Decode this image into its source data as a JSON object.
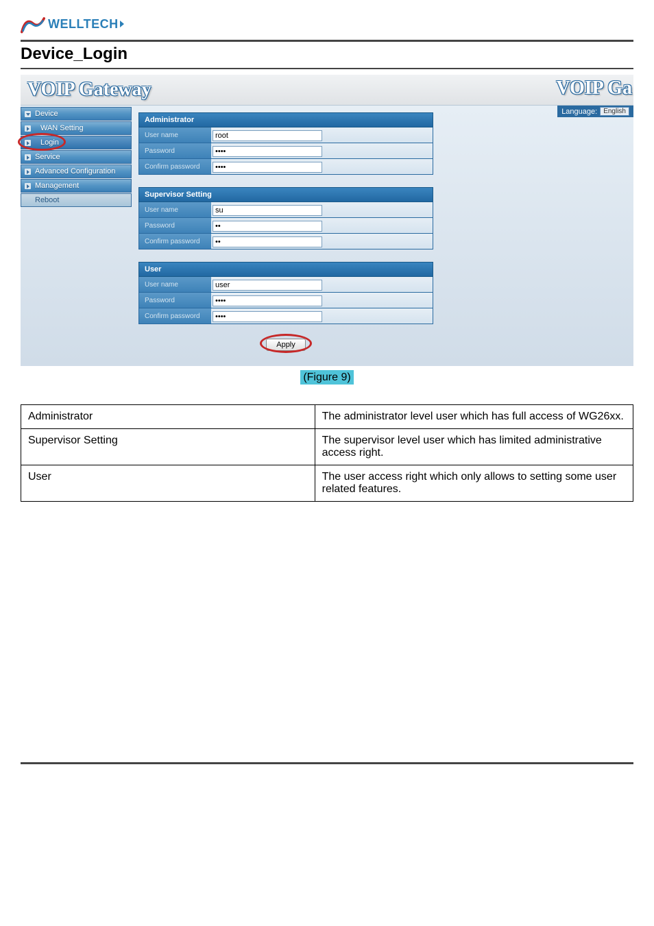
{
  "logo_text": "WELLTECH",
  "page_title": "Device_Login",
  "app_title": "VOIP Gateway",
  "app_title_right": "VOIP Ga",
  "language_label": "Language:",
  "language_value": "English",
  "nav": {
    "device": "Device",
    "wan_setting": "WAN Setting",
    "login": "Login",
    "service": "Service",
    "advanced_conf": "Advanced Configuration",
    "management": "Management",
    "reboot": "Reboot"
  },
  "sections": {
    "admin": {
      "title": "Administrator",
      "user_label": "User name",
      "user_value": "root",
      "password_label": "Password",
      "password_value": "••••",
      "confirm_label": "Confirm password",
      "confirm_value": "••••"
    },
    "supervisor": {
      "title": "Supervisor Setting",
      "user_label": "User name",
      "user_value": "su",
      "password_label": "Password",
      "password_value": "••",
      "confirm_label": "Confirm password",
      "confirm_value": "••"
    },
    "user": {
      "title": "User",
      "user_label": "User name",
      "user_value": "user",
      "password_label": "Password",
      "password_value": "••••",
      "confirm_label": "Confirm password",
      "confirm_value": "••••"
    }
  },
  "apply_label": "Apply",
  "figure_label": "(Figure 9)",
  "descriptions": [
    {
      "term": "Administrator",
      "desc": "The administrator level user which has full access of WG26xx."
    },
    {
      "term": "Supervisor Setting",
      "desc": "The supervisor level user which has limited administrative access right."
    },
    {
      "term": "User",
      "desc": "The user access right which only allows to setting some user related features."
    }
  ]
}
